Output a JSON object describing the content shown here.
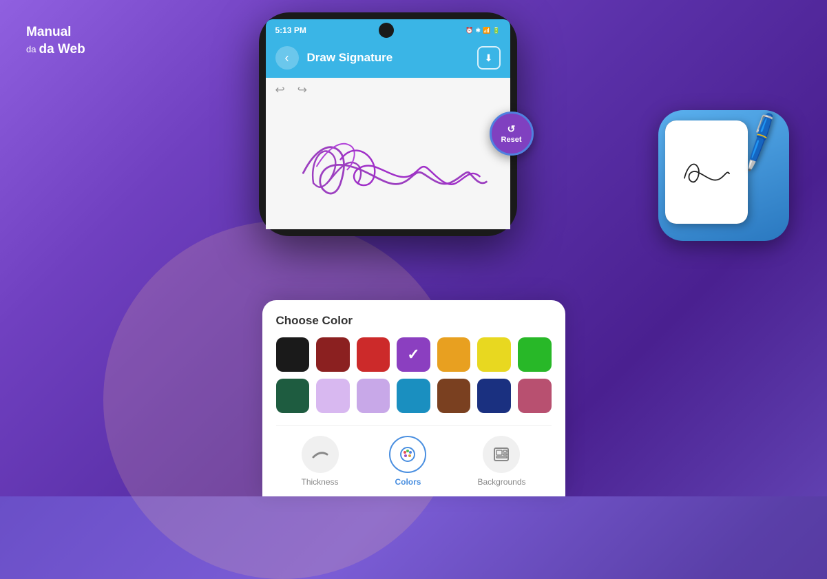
{
  "logo": {
    "line1": "Manual",
    "line2": "da Web"
  },
  "app": {
    "title": "Draw Signature",
    "time": "5:13 PM",
    "back_label": "‹",
    "download_label": "⬇",
    "reset_label": "Reset"
  },
  "color_picker": {
    "title": "Choose Color",
    "colors_row1": [
      {
        "hex": "#1a1a1a",
        "selected": false
      },
      {
        "hex": "#8b2020",
        "selected": false
      },
      {
        "hex": "#cc2a2a",
        "selected": false
      },
      {
        "hex": "#8b3fc0",
        "selected": true
      },
      {
        "hex": "#e8a020",
        "selected": false
      },
      {
        "hex": "#e8d820",
        "selected": false
      },
      {
        "hex": "#28b828",
        "selected": false
      }
    ],
    "colors_row2": [
      {
        "hex": "#1e5c40",
        "selected": false
      },
      {
        "hex": "#d8b8f0",
        "selected": false
      },
      {
        "hex": "#c8a8e8",
        "selected": false
      },
      {
        "hex": "#1a8fc0",
        "selected": false
      },
      {
        "hex": "#7a4020",
        "selected": false
      },
      {
        "hex": "#1a3080",
        "selected": false
      },
      {
        "hex": "#b85070",
        "selected": false
      }
    ]
  },
  "tabs": [
    {
      "id": "thickness",
      "label": "Thickness",
      "active": false,
      "icon": "thickness-icon"
    },
    {
      "id": "colors",
      "label": "Colors",
      "active": true,
      "icon": "palette-icon"
    },
    {
      "id": "backgrounds",
      "label": "Backgrounds",
      "active": false,
      "icon": "backgrounds-icon"
    }
  ],
  "status_icons": "⏰ ✻ 📶 🔋"
}
